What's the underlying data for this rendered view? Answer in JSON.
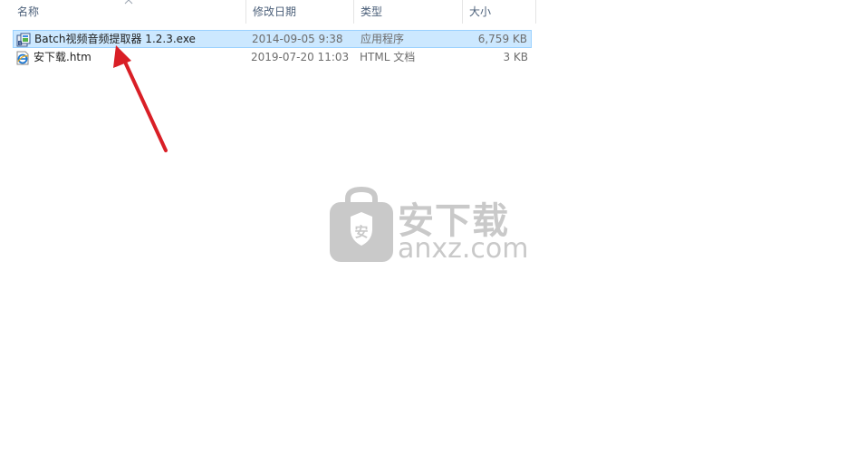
{
  "columns": {
    "name": "名称",
    "date": "修改日期",
    "type": "类型",
    "size": "大小"
  },
  "files": [
    {
      "name": "Batch视频音频提取器 1.2.3.exe",
      "date": "2014-09-05 9:38",
      "type": "应用程序",
      "size": "6,759 KB",
      "icon": "exe-app-icon",
      "selected": true
    },
    {
      "name": "安下载.htm",
      "date": "2019-07-20 11:03",
      "type": "HTML 文档",
      "size": "3 KB",
      "icon": "ie-html-icon",
      "selected": false
    }
  ],
  "watermark": {
    "title": "安下载",
    "domain": "anxz.com",
    "badge": "安"
  },
  "colors": {
    "selection_bg": "#cce8ff",
    "selection_border": "#99d1ff",
    "arrow": "#d91f26",
    "watermark": "#c9c9c9"
  }
}
